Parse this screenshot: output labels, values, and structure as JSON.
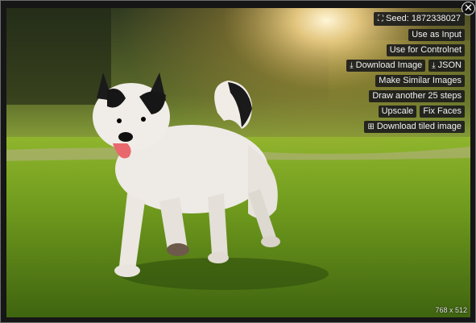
{
  "seed_button": {
    "icon": "expand-icon",
    "label": "Seed: 1872338027"
  },
  "actions": {
    "use_as_input": "Use as Input",
    "use_for_controlnet": "Use for Controlnet",
    "download_image": {
      "icon": "download-icon",
      "label": "Download Image"
    },
    "download_json": {
      "icon": "download-icon",
      "label": "JSON"
    },
    "make_similar": "Make Similar Images",
    "draw_another": "Draw another 25 steps",
    "upscale": "Upscale",
    "fix_faces": "Fix Faces",
    "download_tiled": {
      "icon": "grid-icon",
      "label": "Download tiled image"
    }
  },
  "close_icon": "close-icon",
  "image_dimensions": "768 x 512",
  "image_alt": "White and black dog running on grass",
  "colors": {
    "button_bg": "#1c1c1c",
    "button_text": "#f2f2f2",
    "frame_bg": "#161616"
  }
}
